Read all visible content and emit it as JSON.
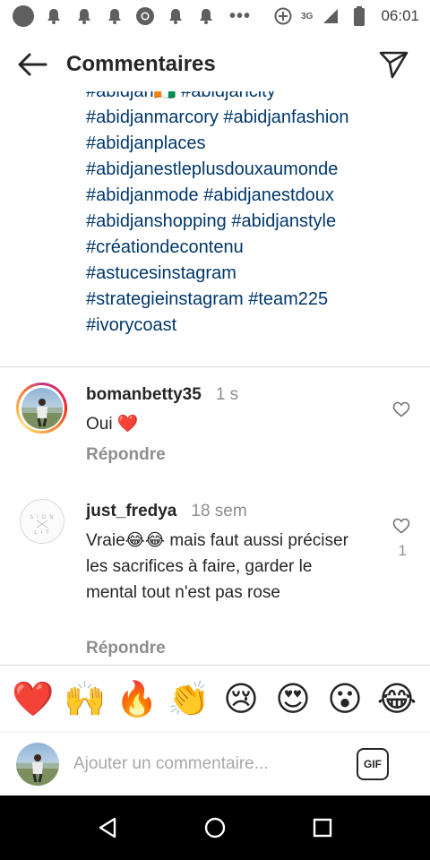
{
  "status_bar": {
    "time": "06:01",
    "network": "3G"
  },
  "header": {
    "title": "Commentaires"
  },
  "caption": {
    "lines": [
      [
        "#abidjan🇨🇮",
        "#abidjancity"
      ],
      [
        "#abidjanmarcory",
        "#abidjanfashion"
      ],
      [
        "#abidjanplaces"
      ],
      [
        "#abidjanestleplusdouxaumonde"
      ],
      [
        "#abidjanmode",
        "#abidjanestdoux"
      ],
      [
        "#abidjanshopping",
        "#abidjanstyle"
      ],
      [
        "#créationdecontenu"
      ],
      [
        "#astucesinstagram"
      ],
      [
        "#strategieinstagram",
        "#team225"
      ],
      [
        "#ivorycoast"
      ]
    ]
  },
  "comments": [
    {
      "username": "bomanbetty35",
      "time": "1 s",
      "text": "Oui ❤️",
      "reply_label": "Répondre"
    },
    {
      "username": "just_fredya",
      "time": "18 sem",
      "text": "Vraie😂😂 mais faut aussi préciser les sacrifices à faire, garder le mental tout n'est pas rose",
      "reply_label": "Répondre",
      "likes": "1"
    }
  ],
  "emoji_bar": [
    "❤️",
    "🙌",
    "🔥",
    "👏",
    "😢",
    "😍",
    "😮",
    "😂"
  ],
  "composer": {
    "placeholder": "Ajouter un commentaire...",
    "gif_label": "GIF"
  },
  "colors": {
    "hashtag": "#00376b",
    "secondary_text": "#8e8e8e",
    "divider": "#dbdbdb"
  }
}
